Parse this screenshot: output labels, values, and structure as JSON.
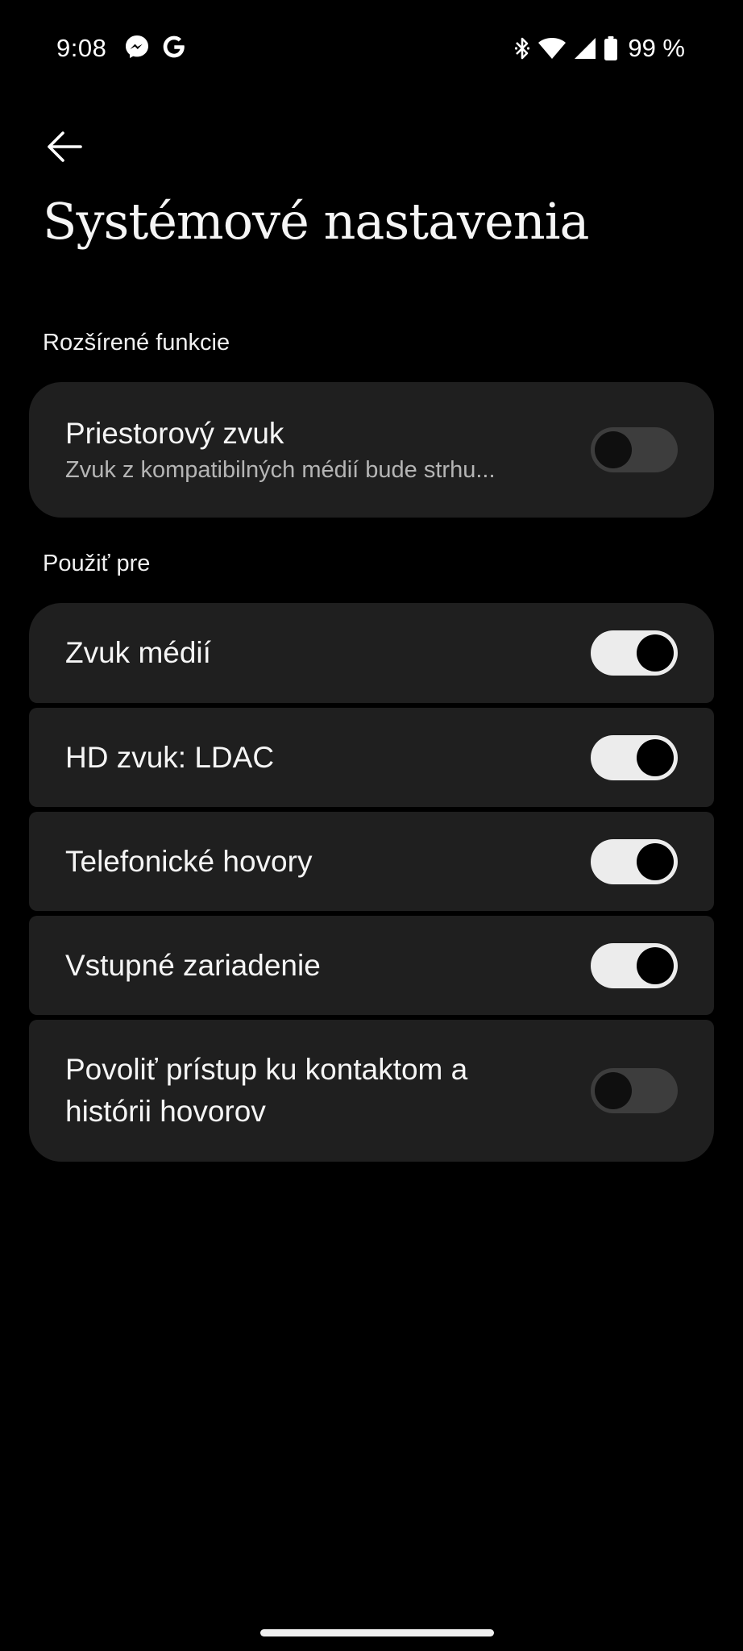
{
  "status_bar": {
    "time": "9:08",
    "left_icons": [
      "messenger-icon",
      "google-icon"
    ],
    "right_icons": [
      "bluetooth-icon",
      "wifi-icon",
      "signal-icon",
      "battery-icon"
    ],
    "battery": "99 %"
  },
  "header": {
    "back_icon": "arrow-left-icon",
    "title": "Systémové nastavenia"
  },
  "sections": {
    "advanced": {
      "header": "Rozšírené funkcie",
      "items": [
        {
          "title": "Priestorový zvuk",
          "subtitle": "Zvuk z kompatibilných médií bude strhu...",
          "enabled": false
        }
      ]
    },
    "use_for": {
      "header": "Použiť pre",
      "items": [
        {
          "title": "Zvuk médií",
          "enabled": true
        },
        {
          "title": "HD zvuk: LDAC",
          "enabled": true
        },
        {
          "title": "Telefonické hovory",
          "enabled": true
        },
        {
          "title": "Vstupné zariadenie",
          "enabled": true
        },
        {
          "title": "Povoliť prístup ku kontaktom a histórii hovorov",
          "enabled": false
        }
      ]
    }
  },
  "colors": {
    "background": "#000000",
    "card": "#1f1f1f",
    "switch_on_track": "#ececec",
    "switch_off_track": "#3d3d3d"
  }
}
